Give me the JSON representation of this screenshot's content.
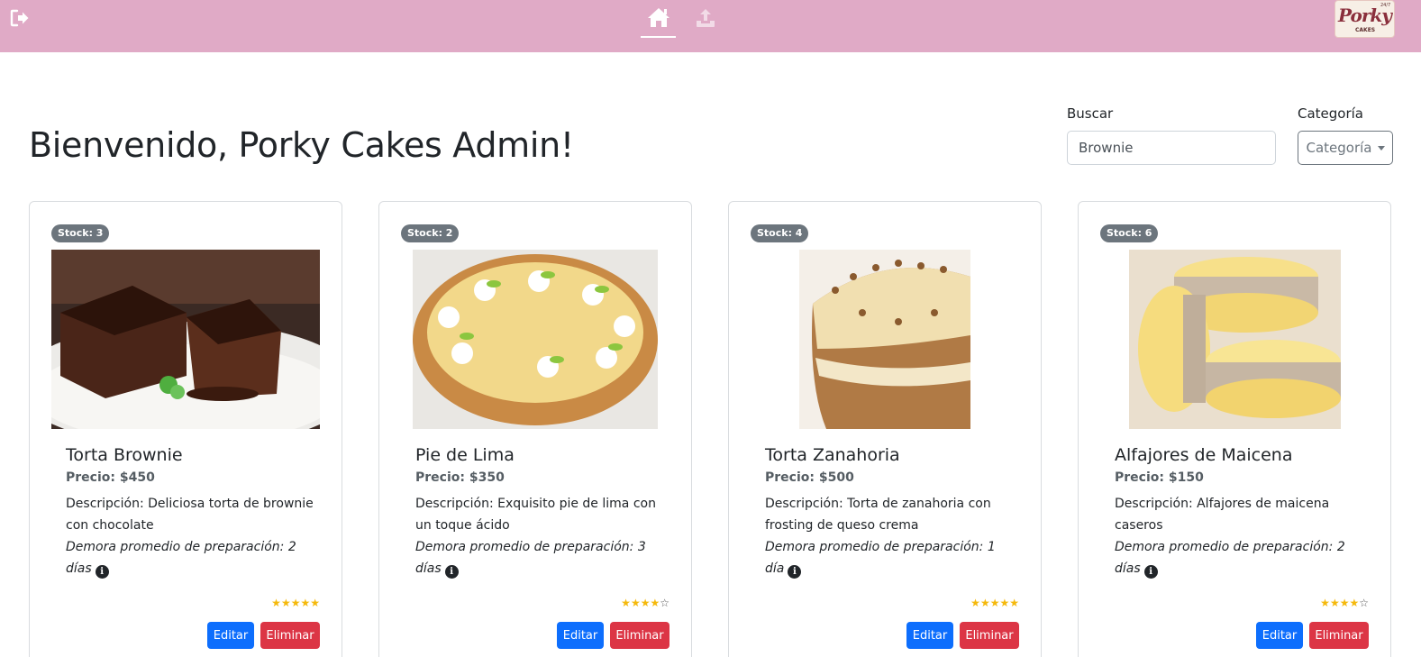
{
  "nav": {
    "icons": [
      "logout-icon",
      "home-icon",
      "upload-icon"
    ],
    "brand": {
      "script": "Porky",
      "sub": "CAKES",
      "tiny": "24/7"
    }
  },
  "header": {
    "welcome": "Bienvenido, Porky Cakes Admin!",
    "search_label": "Buscar",
    "search_value": "Brownie",
    "category_label": "Categoría",
    "category_button": "Categoría"
  },
  "colors": {
    "navbar": "#e0aac6",
    "badge": "#6c757d",
    "edit": "#0d6efd",
    "delete": "#dc3545",
    "star": "#f5b90c"
  },
  "products": [
    {
      "stock": "Stock: 3",
      "image": "brownie-image",
      "title": "Torta Brownie",
      "price": "Precio: $450",
      "description": "Descripción: Deliciosa torta de brownie con chocolate",
      "prep": "Demora promedio de preparación: 2 días",
      "rating": 5,
      "edit": "Editar",
      "delete": "Eliminar"
    },
    {
      "stock": "Stock: 2",
      "image": "lime-pie-image",
      "title": "Pie de Lima",
      "price": "Precio: $350",
      "description": "Descripción: Exquisito pie de lima con un toque ácido",
      "prep": "Demora promedio de preparación: 3 días",
      "rating": 4,
      "edit": "Editar",
      "delete": "Eliminar"
    },
    {
      "stock": "Stock: 4",
      "image": "carrot-cake-image",
      "title": "Torta Zanahoria",
      "price": "Precio: $500",
      "description": "Descripción: Torta de zanahoria con frosting de queso crema",
      "prep": "Demora promedio de preparación: 1 día",
      "rating": 5,
      "edit": "Editar",
      "delete": "Eliminar"
    },
    {
      "stock": "Stock: 6",
      "image": "alfajores-image",
      "title": "Alfajores de Maicena",
      "price": "Precio: $150",
      "description": "Descripción: Alfajores de maicena caseros",
      "prep": "Demora promedio de preparación: 2 días",
      "rating": 4,
      "edit": "Editar",
      "delete": "Eliminar"
    }
  ]
}
